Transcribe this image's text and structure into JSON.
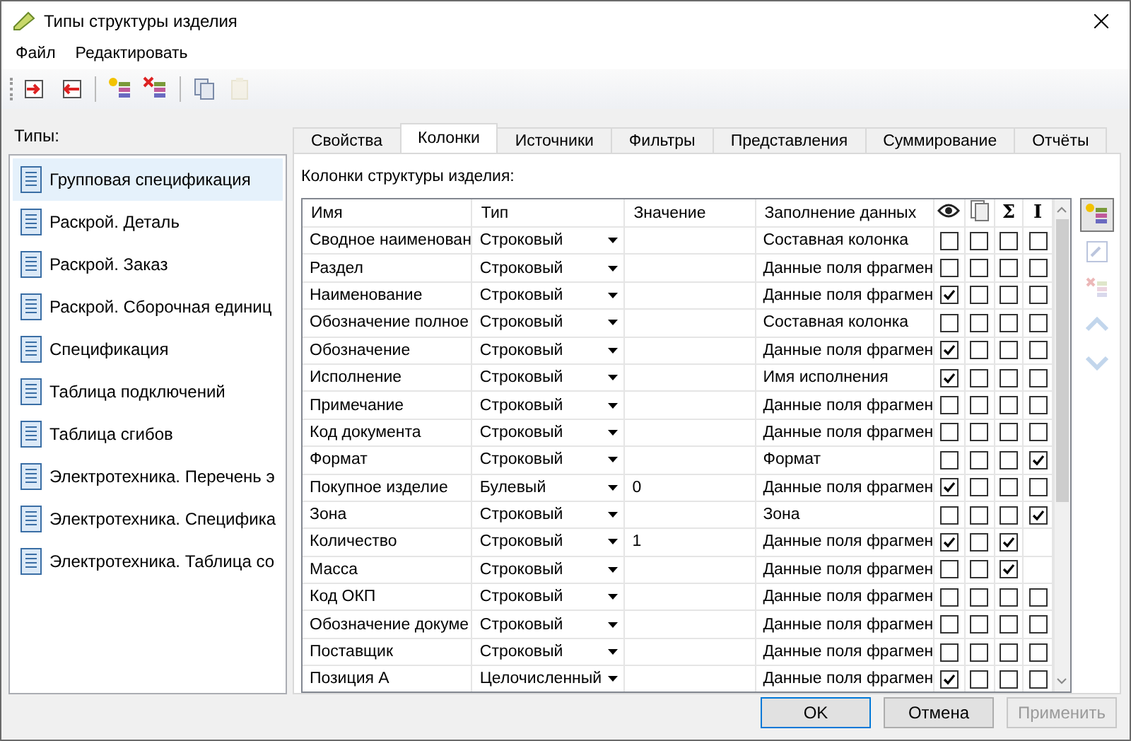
{
  "window": {
    "title": "Типы структуры изделия"
  },
  "menu": [
    "Файл",
    "Редактировать"
  ],
  "toolbar": [
    {
      "kind": "import",
      "disabled": false
    },
    {
      "kind": "export",
      "disabled": false
    },
    {
      "kind": "add",
      "disabled": false
    },
    {
      "kind": "remove",
      "disabled": false
    },
    {
      "kind": "copy",
      "disabled": false
    },
    {
      "kind": "paste",
      "disabled": true
    }
  ],
  "sidebar": {
    "label": "Типы:",
    "items": [
      {
        "label": "Групповая спецификация",
        "selected": true
      },
      {
        "label": "Раскрой. Деталь",
        "selected": false
      },
      {
        "label": "Раскрой. Заказ",
        "selected": false
      },
      {
        "label": "Раскрой. Сборочная единиц",
        "selected": false
      },
      {
        "label": "Спецификация",
        "selected": false
      },
      {
        "label": "Таблица подключений",
        "selected": false
      },
      {
        "label": "Таблица сгибов",
        "selected": false
      },
      {
        "label": "Электротехника. Перечень э",
        "selected": false
      },
      {
        "label": "Электротехника. Специфика",
        "selected": false
      },
      {
        "label": "Электротехника. Таблица со",
        "selected": false
      }
    ]
  },
  "tabs": [
    {
      "label": "Свойства",
      "selected": false
    },
    {
      "label": "Колонки",
      "selected": true
    },
    {
      "label": "Источники",
      "selected": false
    },
    {
      "label": "Фильтры",
      "selected": false
    },
    {
      "label": "Представления",
      "selected": false
    },
    {
      "label": "Суммирование",
      "selected": false
    },
    {
      "label": "Отчёты",
      "selected": false
    }
  ],
  "panel_label": "Колонки структуры изделия:",
  "table": {
    "columns": [
      "Имя",
      "Тип",
      "Значение",
      "Заполнение данных"
    ],
    "flag_columns": [
      {
        "kind": "eye"
      },
      {
        "kind": "pages"
      },
      {
        "kind": "text",
        "label": "Σ"
      },
      {
        "kind": "text",
        "label": "I"
      }
    ],
    "rows": [
      {
        "name": "Сводное наименован",
        "type": "Строковый",
        "value": "",
        "fill": "Составная колонка",
        "flags": [
          false,
          false,
          false,
          false
        ]
      },
      {
        "name": "Раздел",
        "type": "Строковый",
        "value": "",
        "fill": "Данные поля фрагмен",
        "flags": [
          false,
          false,
          false,
          false
        ]
      },
      {
        "name": "Наименование",
        "type": "Строковый",
        "value": "",
        "fill": "Данные поля фрагмен",
        "flags": [
          true,
          false,
          false,
          false
        ]
      },
      {
        "name": "Обозначение полное",
        "type": "Строковый",
        "value": "",
        "fill": "Составная колонка",
        "flags": [
          false,
          false,
          false,
          false
        ]
      },
      {
        "name": "Обозначение",
        "type": "Строковый",
        "value": "",
        "fill": "Данные поля фрагмен",
        "flags": [
          true,
          false,
          false,
          false
        ]
      },
      {
        "name": "Исполнение",
        "type": "Строковый",
        "value": "",
        "fill": "Имя исполнения",
        "flags": [
          true,
          false,
          false,
          false
        ]
      },
      {
        "name": "Примечание",
        "type": "Строковый",
        "value": "",
        "fill": "Данные поля фрагмен",
        "flags": [
          false,
          false,
          false,
          false
        ]
      },
      {
        "name": "Код документа",
        "type": "Строковый",
        "value": "",
        "fill": "Данные поля фрагмен",
        "flags": [
          false,
          false,
          false,
          false
        ]
      },
      {
        "name": "Формат",
        "type": "Строковый",
        "value": "",
        "fill": "Формат",
        "flags": [
          false,
          false,
          false,
          true
        ]
      },
      {
        "name": "Покупное изделие",
        "type": "Булевый",
        "value": "0",
        "fill": "Данные поля фрагмен",
        "flags": [
          true,
          false,
          false,
          false
        ]
      },
      {
        "name": "Зона",
        "type": "Строковый",
        "value": "",
        "fill": "Зона",
        "flags": [
          false,
          false,
          false,
          true
        ]
      },
      {
        "name": "Количество",
        "type": "Строковый",
        "value": "1",
        "fill": "Данные поля фрагмен",
        "flags": [
          true,
          false,
          true
        ]
      },
      {
        "name": "Масса",
        "type": "Строковый",
        "value": "",
        "fill": "Данные поля фрагмен",
        "flags": [
          false,
          false,
          true
        ]
      },
      {
        "name": "Код ОКП",
        "type": "Строковый",
        "value": "",
        "fill": "Данные поля фрагмен",
        "flags": [
          false,
          false,
          false,
          false
        ]
      },
      {
        "name": "Обозначение докуме",
        "type": "Строковый",
        "value": "",
        "fill": "Данные поля фрагмен",
        "flags": [
          false,
          false,
          false,
          false
        ]
      },
      {
        "name": "Поставщик",
        "type": "Строковый",
        "value": "",
        "fill": "Данные поля фрагмен",
        "flags": [
          false,
          false,
          false,
          false
        ]
      },
      {
        "name": "Позиция А",
        "type": "Целочисленный",
        "value": "",
        "fill": "Данные поля фрагмен",
        "flags": [
          true,
          false,
          false,
          false
        ]
      }
    ]
  },
  "side_buttons": [
    {
      "kind": "add",
      "disabled": false
    },
    {
      "kind": "edit",
      "disabled": true
    },
    {
      "kind": "delete",
      "disabled": true
    },
    {
      "kind": "up",
      "disabled": true
    },
    {
      "kind": "down",
      "disabled": true
    }
  ],
  "buttons": [
    {
      "label": "OK",
      "disabled": false
    },
    {
      "label": "Отмена",
      "disabled": false
    },
    {
      "label": "Применить",
      "disabled": true
    }
  ]
}
